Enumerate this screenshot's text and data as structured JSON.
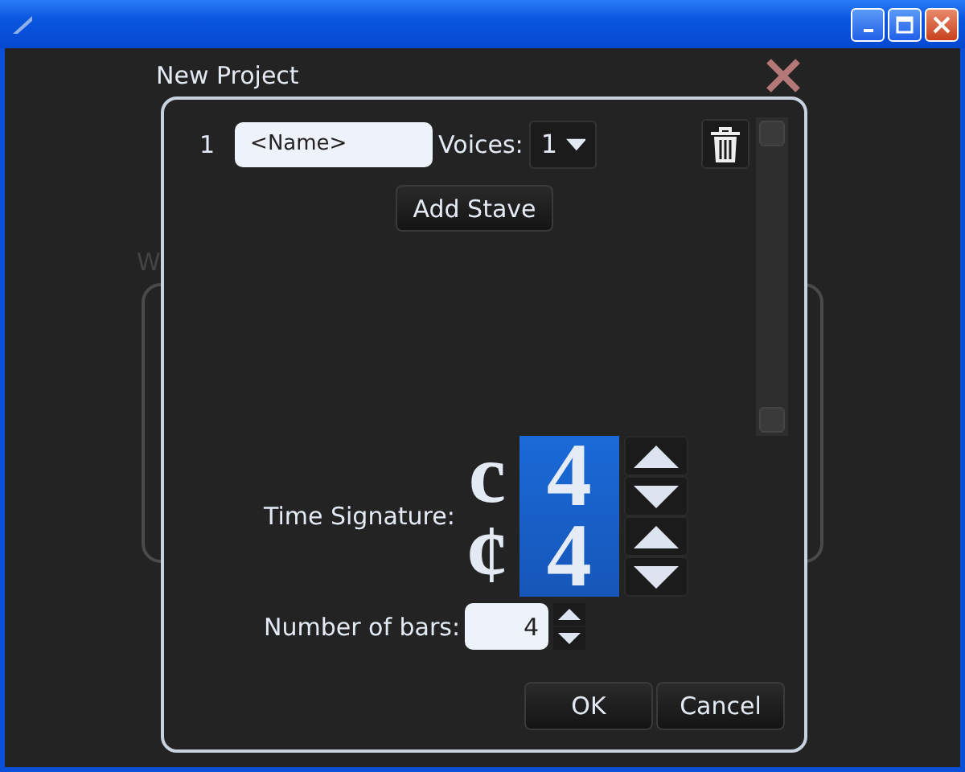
{
  "background": {
    "label": "W"
  },
  "dialog": {
    "title": "New Project",
    "staves": [
      {
        "number": "1",
        "name": "<Name>",
        "voices_label": "Voices:",
        "voices": "1"
      }
    ],
    "add_stave": "Add Stave",
    "time_signature": {
      "label": "Time Signature:",
      "rows": [
        {
          "symbol": "c",
          "value": "4"
        },
        {
          "symbol": "¢",
          "value": "4"
        }
      ]
    },
    "bars": {
      "label": "Number of bars:",
      "value": "4"
    },
    "buttons": [
      "OK",
      "Cancel"
    ]
  }
}
